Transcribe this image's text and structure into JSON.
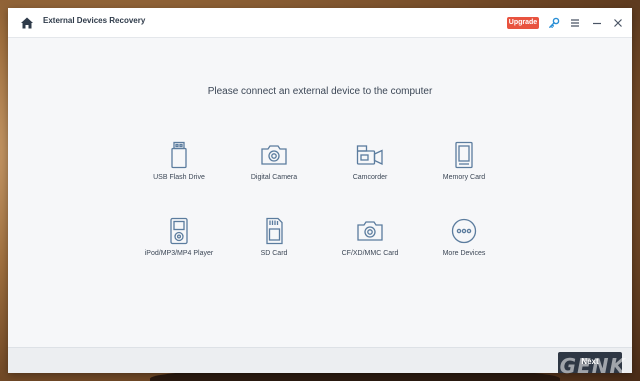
{
  "app": {
    "title": "External Devices Recovery",
    "upgrade_label": "Upgrade"
  },
  "colors": {
    "accent_upgrade": "#e8533f",
    "icon_stroke": "#5b7c9e",
    "next_button": "#2e3744"
  },
  "icons": {
    "home": "home-icon",
    "key": "key-icon",
    "menu": "menu-icon",
    "minimize": "minimize-icon",
    "close": "close-icon"
  },
  "main": {
    "prompt": "Please connect an external device to the computer",
    "devices": [
      {
        "label": "USB Flash Drive",
        "icon": "usb-flash-drive-icon"
      },
      {
        "label": "Digital Camera",
        "icon": "digital-camera-icon"
      },
      {
        "label": "Camcorder",
        "icon": "camcorder-icon"
      },
      {
        "label": "Memory Card",
        "icon": "memory-card-icon"
      },
      {
        "label": "iPod/MP3/MP4 Player",
        "icon": "media-player-icon"
      },
      {
        "label": "SD Card",
        "icon": "sd-card-icon"
      },
      {
        "label": "CF/XD/MMC Card",
        "icon": "cf-card-icon"
      },
      {
        "label": "More Devices",
        "icon": "more-devices-icon"
      }
    ]
  },
  "footer": {
    "next_label": "Next"
  },
  "watermark": "GENK"
}
